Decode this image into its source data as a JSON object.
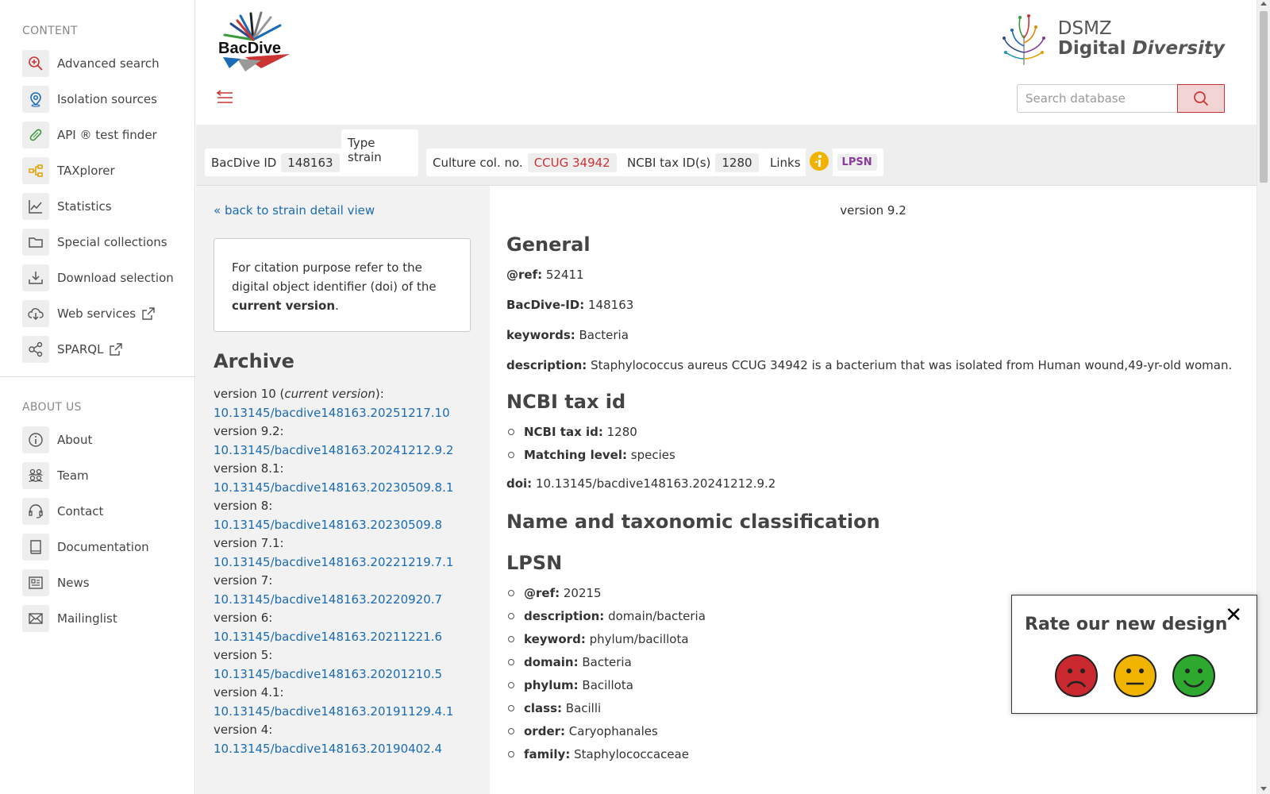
{
  "sidebar": {
    "content_heading": "CONTENT",
    "content_items": [
      {
        "label": "Advanced search"
      },
      {
        "label": "Isolation sources"
      },
      {
        "label": "API ® test finder"
      },
      {
        "label": "TAXplorer"
      },
      {
        "label": "Statistics"
      },
      {
        "label": "Special collections"
      },
      {
        "label": "Download selection"
      },
      {
        "label": "Web services"
      },
      {
        "label": "SPARQL"
      }
    ],
    "about_heading": "ABOUT US",
    "about_items": [
      {
        "label": "About"
      },
      {
        "label": "Team"
      },
      {
        "label": "Contact"
      },
      {
        "label": "Documentation"
      },
      {
        "label": "News"
      },
      {
        "label": "Mailinglist"
      }
    ]
  },
  "header": {
    "logo_text": "BacDive",
    "dsmz_line1": "DSMZ",
    "dsmz_line2a": "Digital ",
    "dsmz_line2b": "Diversity",
    "search_placeholder": "Search database"
  },
  "strain": {
    "bacdive_id_label": "BacDive ID",
    "bacdive_id": "148163",
    "type_strain_label": "Type strain",
    "culture_label": "Culture col. no.",
    "culture_value": "CCUG 34942",
    "ncbi_label": "NCBI tax ID(s)",
    "ncbi_value": "1280",
    "links_label": "Links",
    "lpsn_badge": "LPSN"
  },
  "archive": {
    "back_link": "« back to strain detail view",
    "citation_text": "For citation purpose refer to the digital object identifier (doi) of the ",
    "citation_bold": "current version",
    "citation_end": ".",
    "title": "Archive",
    "current_prefix": "version 10 (",
    "current_italic": "current version",
    "current_suffix": "):",
    "versions": [
      {
        "label": "version 10",
        "doi": "10.13145/bacdive148163.20251217.10"
      },
      {
        "label": "version 9.2:",
        "doi": "10.13145/bacdive148163.20241212.9.2"
      },
      {
        "label": "version 8.1:",
        "doi": "10.13145/bacdive148163.20230509.8.1"
      },
      {
        "label": "version 8:",
        "doi": "10.13145/bacdive148163.20230509.8"
      },
      {
        "label": "version 7.1:",
        "doi": "10.13145/bacdive148163.20221219.7.1"
      },
      {
        "label": "version 7:",
        "doi": "10.13145/bacdive148163.20220920.7"
      },
      {
        "label": "version 6:",
        "doi": "10.13145/bacdive148163.20211221.6"
      },
      {
        "label": "version 5:",
        "doi": "10.13145/bacdive148163.20201210.5"
      },
      {
        "label": "version 4.1:",
        "doi": "10.13145/bacdive148163.20191129.4.1"
      },
      {
        "label": "version 4:",
        "doi": "10.13145/bacdive148163.20190402.4"
      }
    ]
  },
  "main": {
    "version_label": "version 9.2",
    "general_title": "General",
    "ref_label": "@ref:",
    "ref_value": " 52411",
    "bacdive_id_label": "BacDive-ID:",
    "bacdive_id_value": " 148163",
    "keywords_label": "keywords:",
    "keywords_value": " Bacteria",
    "description_label": "description:",
    "description_value": " Staphylococcus aureus CCUG 34942 is a bacterium that was isolated from Human wound,49-yr-old woman.",
    "ncbi_title": "NCBI tax id",
    "ncbi_items": [
      {
        "label": "NCBI tax id:",
        "value": " 1280"
      },
      {
        "label": "Matching level:",
        "value": " species"
      }
    ],
    "doi_label": "doi:",
    "doi_value": " 10.13145/bacdive148163.20241212.9.2",
    "taxonomy_title": "Name and taxonomic classification",
    "lpsn_title": "LPSN",
    "lpsn_items": [
      {
        "label": "@ref:",
        "value": " 20215"
      },
      {
        "label": "description:",
        "value": " domain/bacteria"
      },
      {
        "label": "keyword:",
        "value": " phylum/bacillota"
      },
      {
        "label": "domain:",
        "value": " Bacteria"
      },
      {
        "label": "phylum:",
        "value": " Bacillota"
      },
      {
        "label": "class:",
        "value": " Bacilli"
      },
      {
        "label": "order:",
        "value": " Caryophanales"
      },
      {
        "label": "family:",
        "value": " Staphylococcaceae"
      }
    ]
  },
  "rating": {
    "title": "Rate our new design",
    "close": "✕"
  }
}
